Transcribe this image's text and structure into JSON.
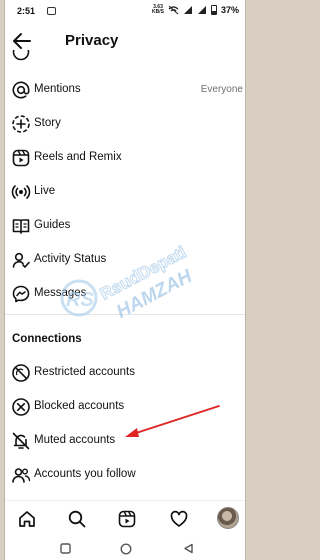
{
  "status_bar": {
    "time": "2:51",
    "speed_value": "3.63",
    "speed_unit": "KB/S",
    "battery": "37%"
  },
  "header": {
    "title": "Privacy"
  },
  "items": [
    {
      "label": "Mentions",
      "value": "Everyone",
      "icon": "at-icon"
    },
    {
      "label": "Story",
      "icon": "story-icon"
    },
    {
      "label": "Reels and Remix",
      "icon": "reels-icon"
    },
    {
      "label": "Live",
      "icon": "live-icon"
    },
    {
      "label": "Guides",
      "icon": "guides-icon"
    },
    {
      "label": "Activity Status",
      "icon": "activity-status-icon"
    },
    {
      "label": "Messages",
      "icon": "messenger-icon"
    }
  ],
  "connections": {
    "heading": "Connections",
    "items": [
      {
        "label": "Restricted accounts",
        "icon": "restricted-icon"
      },
      {
        "label": "Blocked accounts",
        "icon": "blocked-icon"
      },
      {
        "label": "Muted accounts",
        "icon": "muted-bell-icon"
      },
      {
        "label": "Accounts you follow",
        "icon": "people-icon"
      }
    ]
  },
  "watermark": {
    "line1": "RsudDepati",
    "line2": "HAMZAH",
    "monogram": "RS"
  },
  "annotation": {
    "arrow_color": "#e02424",
    "points_to": "Muted accounts"
  },
  "bottom_nav": [
    "home-icon",
    "search-icon",
    "reels-icon",
    "activity-heart-icon",
    "profile-avatar"
  ],
  "system_nav": [
    "recents-square-icon",
    "home-circle-icon",
    "back-triangle-icon"
  ]
}
